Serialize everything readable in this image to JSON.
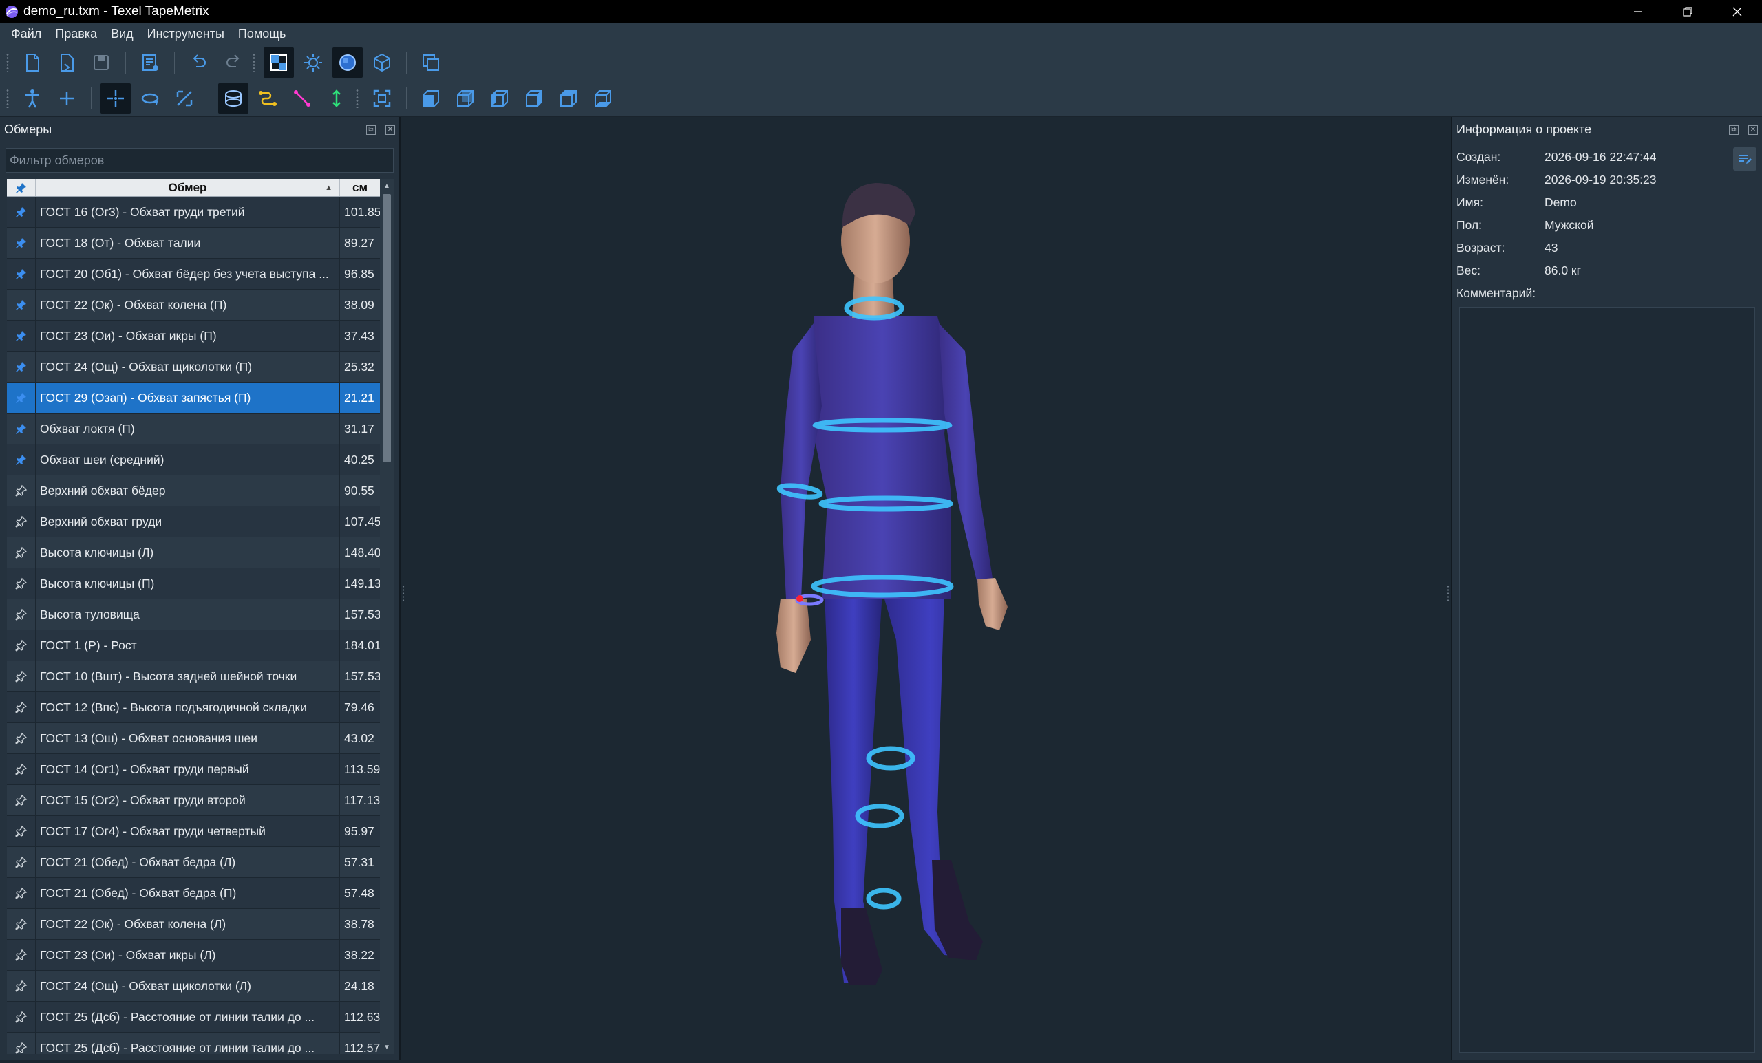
{
  "window": {
    "title": "demo_ru.txm  - Texel TapeMetrix",
    "minimize_icon": "minimize-icon",
    "restore_icon": "restore-icon",
    "close_icon": "close-icon"
  },
  "menu": {
    "items": [
      "Файл",
      "Правка",
      "Вид",
      "Инструменты",
      "Помощь"
    ]
  },
  "colors": {
    "accent": "#1e73c8",
    "toolbar_icon": "#4a9ae8",
    "ring": "#3fc6ff",
    "body": "#3a3ab8"
  },
  "measurements": {
    "panel_title": "Обмеры",
    "filter_placeholder": "Фильтр обмеров",
    "col_name": "Обмер",
    "col_unit": "см",
    "rows": [
      {
        "name": "ГОСТ 16 (Ог3) - Обхват груди третий",
        "value": "101.85",
        "pinned": true
      },
      {
        "name": "ГОСТ 18 (От) - Обхват талии",
        "value": "89.27",
        "pinned": true
      },
      {
        "name": "ГОСТ 20 (Об1) - Обхват бёдер без учета выступа ...",
        "value": "96.85",
        "pinned": true
      },
      {
        "name": "ГОСТ 22 (Ок) - Обхват колена (П)",
        "value": "38.09",
        "pinned": true
      },
      {
        "name": "ГОСТ 23 (Ои) - Обхват икры (П)",
        "value": "37.43",
        "pinned": true
      },
      {
        "name": "ГОСТ 24 (Ощ) - Обхват щиколотки (П)",
        "value": "25.32",
        "pinned": true
      },
      {
        "name": "ГОСТ 29 (Озап) - Обхват запястья (П)",
        "value": "21.21",
        "pinned": true,
        "selected": true
      },
      {
        "name": "Обхват локтя (П)",
        "value": "31.17",
        "pinned": true
      },
      {
        "name": "Обхват шеи (средний)",
        "value": "40.25",
        "pinned": true
      },
      {
        "name": "Верхний обхват бёдер",
        "value": "90.55",
        "pinned": false
      },
      {
        "name": "Верхний обхват груди",
        "value": "107.45",
        "pinned": false
      },
      {
        "name": "Высота ключицы (Л)",
        "value": "148.40",
        "pinned": false
      },
      {
        "name": "Высота ключицы (П)",
        "value": "149.13",
        "pinned": false
      },
      {
        "name": "Высота туловища",
        "value": "157.53",
        "pinned": false
      },
      {
        "name": "ГОСТ 1 (Р) - Рост",
        "value": "184.01",
        "pinned": false
      },
      {
        "name": "ГОСТ 10 (Вшт) - Высота задней шейной точки",
        "value": "157.53",
        "pinned": false
      },
      {
        "name": "ГОСТ 12 (Впс) - Высота подъягодичной складки",
        "value": "79.46",
        "pinned": false
      },
      {
        "name": "ГОСТ 13 (Ош) - Обхват основания шеи",
        "value": "43.02",
        "pinned": false
      },
      {
        "name": "ГОСТ 14 (Ог1) - Обхват груди первый",
        "value": "113.59",
        "pinned": false
      },
      {
        "name": "ГОСТ 15 (Ог2) - Обхват груди второй",
        "value": "117.13",
        "pinned": false
      },
      {
        "name": "ГОСТ 17 (Ог4) - Обхват груди четвертый",
        "value": "95.97",
        "pinned": false
      },
      {
        "name": "ГОСТ 21 (Обед) - Обхват бедра (Л)",
        "value": "57.31",
        "pinned": false
      },
      {
        "name": "ГОСТ 21 (Обед) - Обхват бедра (П)",
        "value": "57.48",
        "pinned": false
      },
      {
        "name": "ГОСТ 22 (Ок) - Обхват колена (Л)",
        "value": "38.78",
        "pinned": false
      },
      {
        "name": "ГОСТ 23 (Ои) - Обхват икры (Л)",
        "value": "38.22",
        "pinned": false
      },
      {
        "name": "ГОСТ 24 (Ощ) - Обхват щиколотки (Л)",
        "value": "24.18",
        "pinned": false
      },
      {
        "name": "ГОСТ 25 (Дсб) - Расстояние от линии талии до ...",
        "value": "112.63",
        "pinned": false
      },
      {
        "name": "ГОСТ 25 (Дсб) - Расстояние от линии талии до ...",
        "value": "112.57",
        "pinned": false
      }
    ]
  },
  "project_info": {
    "panel_title": "Информация о проекте",
    "fields": [
      {
        "label": "Создан:",
        "value": "2026-09-16 22:47:44"
      },
      {
        "label": "Изменён:",
        "value": "2026-09-19 20:35:23"
      },
      {
        "label": "Имя:",
        "value": "Demo"
      },
      {
        "label": "Пол:",
        "value": "Мужской"
      },
      {
        "label": "Возраст:",
        "value": "43"
      },
      {
        "label": "Вес:",
        "value": "86.0 кг"
      },
      {
        "label": "Комментарий:",
        "value": ""
      }
    ]
  }
}
